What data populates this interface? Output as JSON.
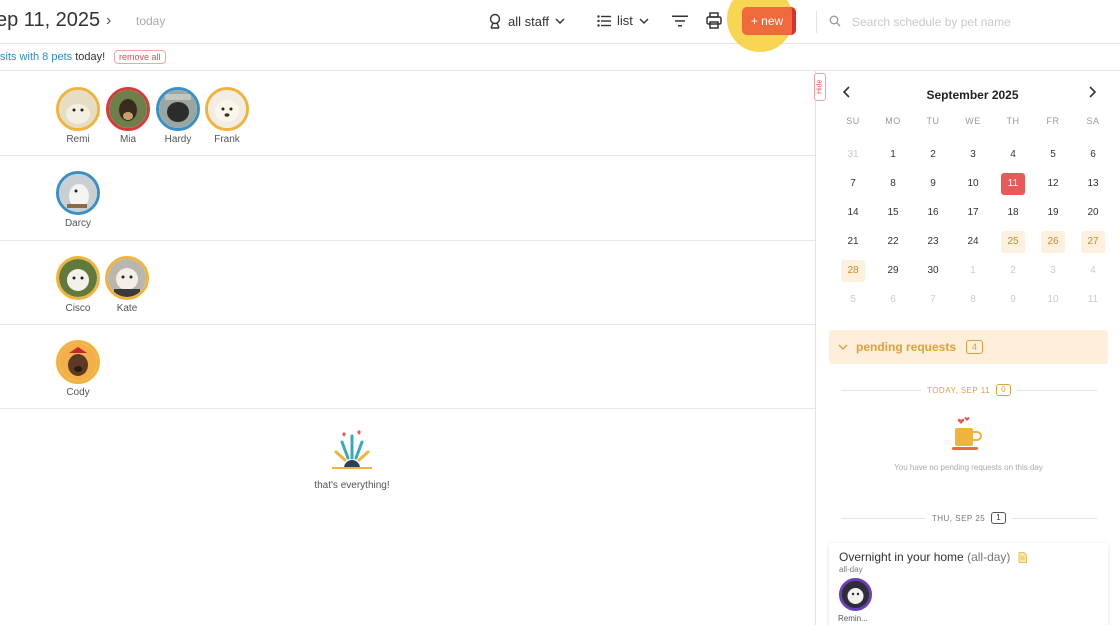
{
  "header": {
    "date_title": "ep 11, 2025",
    "next_symbol": "›",
    "today_label": "today",
    "staff_label": "all staff",
    "view_label": "list",
    "new_label": "+ new",
    "search_placeholder": "Search schedule by pet name"
  },
  "subbar": {
    "prefix_link": "sits with 8 pets",
    "suffix": " today!",
    "remove_all_label": "remove all"
  },
  "visits": [
    {
      "pets": [
        {
          "name": "Remi",
          "ring": "gold"
        },
        {
          "name": "Mia",
          "ring": "red"
        },
        {
          "name": "Hardy",
          "ring": "blue"
        },
        {
          "name": "Frank",
          "ring": "gold"
        }
      ]
    },
    {
      "pets": [
        {
          "name": "Darcy",
          "ring": "blue"
        }
      ]
    },
    {
      "pets": [
        {
          "name": "Cisco",
          "ring": "gold"
        },
        {
          "name": "Kate",
          "ring": "gold"
        }
      ]
    },
    {
      "pets": [
        {
          "name": "Cody",
          "ring": "gold"
        }
      ]
    }
  ],
  "end_message": "that's everything!",
  "sidebar": {
    "hide_label": "Hide",
    "calendar": {
      "title": "September 2025",
      "weekdays": [
        "SU",
        "MO",
        "TU",
        "WE",
        "TH",
        "FR",
        "SA"
      ],
      "days": [
        {
          "n": "31",
          "s": "muted"
        },
        {
          "n": "1"
        },
        {
          "n": "2"
        },
        {
          "n": "3"
        },
        {
          "n": "4"
        },
        {
          "n": "5"
        },
        {
          "n": "6"
        },
        {
          "n": "7"
        },
        {
          "n": "8"
        },
        {
          "n": "9"
        },
        {
          "n": "10"
        },
        {
          "n": "11",
          "s": "sel"
        },
        {
          "n": "12"
        },
        {
          "n": "13"
        },
        {
          "n": "14"
        },
        {
          "n": "15"
        },
        {
          "n": "16"
        },
        {
          "n": "17"
        },
        {
          "n": "18"
        },
        {
          "n": "19"
        },
        {
          "n": "20"
        },
        {
          "n": "21"
        },
        {
          "n": "22"
        },
        {
          "n": "23"
        },
        {
          "n": "24"
        },
        {
          "n": "25",
          "s": "hl"
        },
        {
          "n": "26",
          "s": "hl"
        },
        {
          "n": "27",
          "s": "hl"
        },
        {
          "n": "28",
          "s": "hl"
        },
        {
          "n": "29"
        },
        {
          "n": "30"
        },
        {
          "n": "1",
          "s": "muted"
        },
        {
          "n": "2",
          "s": "muted"
        },
        {
          "n": "3",
          "s": "muted"
        },
        {
          "n": "4",
          "s": "muted"
        },
        {
          "n": "5",
          "s": "muted"
        },
        {
          "n": "6",
          "s": "muted"
        },
        {
          "n": "7",
          "s": "muted"
        },
        {
          "n": "8",
          "s": "muted"
        },
        {
          "n": "9",
          "s": "muted"
        },
        {
          "n": "10",
          "s": "muted"
        },
        {
          "n": "11",
          "s": "muted"
        }
      ]
    },
    "pending": {
      "label": "pending requests",
      "count": "4",
      "today_header": "TODAY, SEP 11",
      "today_count": "0",
      "empty_text": "You have no pending requests on this day",
      "next_header": "THU, SEP 25",
      "next_count": "1",
      "request": {
        "title": "Overnight in your home",
        "title_suffix": "(all-day)",
        "subtitle": "all-day",
        "pet_name": "Remin..."
      }
    }
  },
  "colors": {
    "accent": "#ef6a3a",
    "highlight_halo": "#f8d34a",
    "link": "#2a8fc4",
    "selected_day": "#e85a5a",
    "pending": "#e0a03c"
  }
}
